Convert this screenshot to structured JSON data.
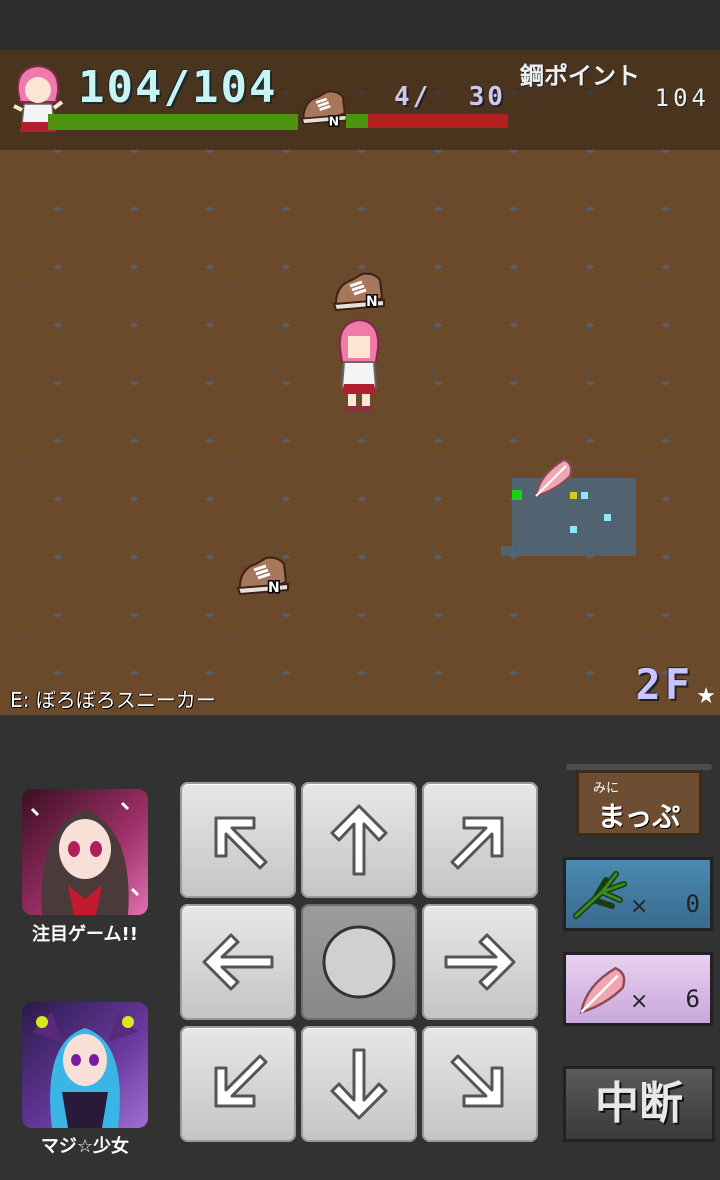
{
  "hud": {
    "hp": "104/104",
    "hp_fraction": 1.0,
    "durability": "4/  30",
    "durability_fraction": 0.133,
    "steel_points_label": "鋼ポイント",
    "steel_points_value": "104"
  },
  "field": {
    "equipped_label": "E: ぼろぼろスニーカー",
    "floor": "2F",
    "floor_star": "★"
  },
  "sidebar": {
    "featured_game_label": "注目ゲーム!!",
    "magi_label": "マジ☆少女"
  },
  "right_panel": {
    "map_small": "みに",
    "map_big": "まっぷ",
    "leaf_count": "0",
    "feather_count": "6",
    "times_symbol": "×",
    "quit_label": "中断"
  },
  "colors": {
    "hp_bar": "#4e9410",
    "durability_bar": "#b21f1f",
    "ground": "#6b4a2b",
    "minimap": "#3c78aa"
  },
  "dpad": [
    "up-left",
    "up",
    "up-right",
    "left",
    "wait",
    "right",
    "down-left",
    "down",
    "down-right"
  ]
}
